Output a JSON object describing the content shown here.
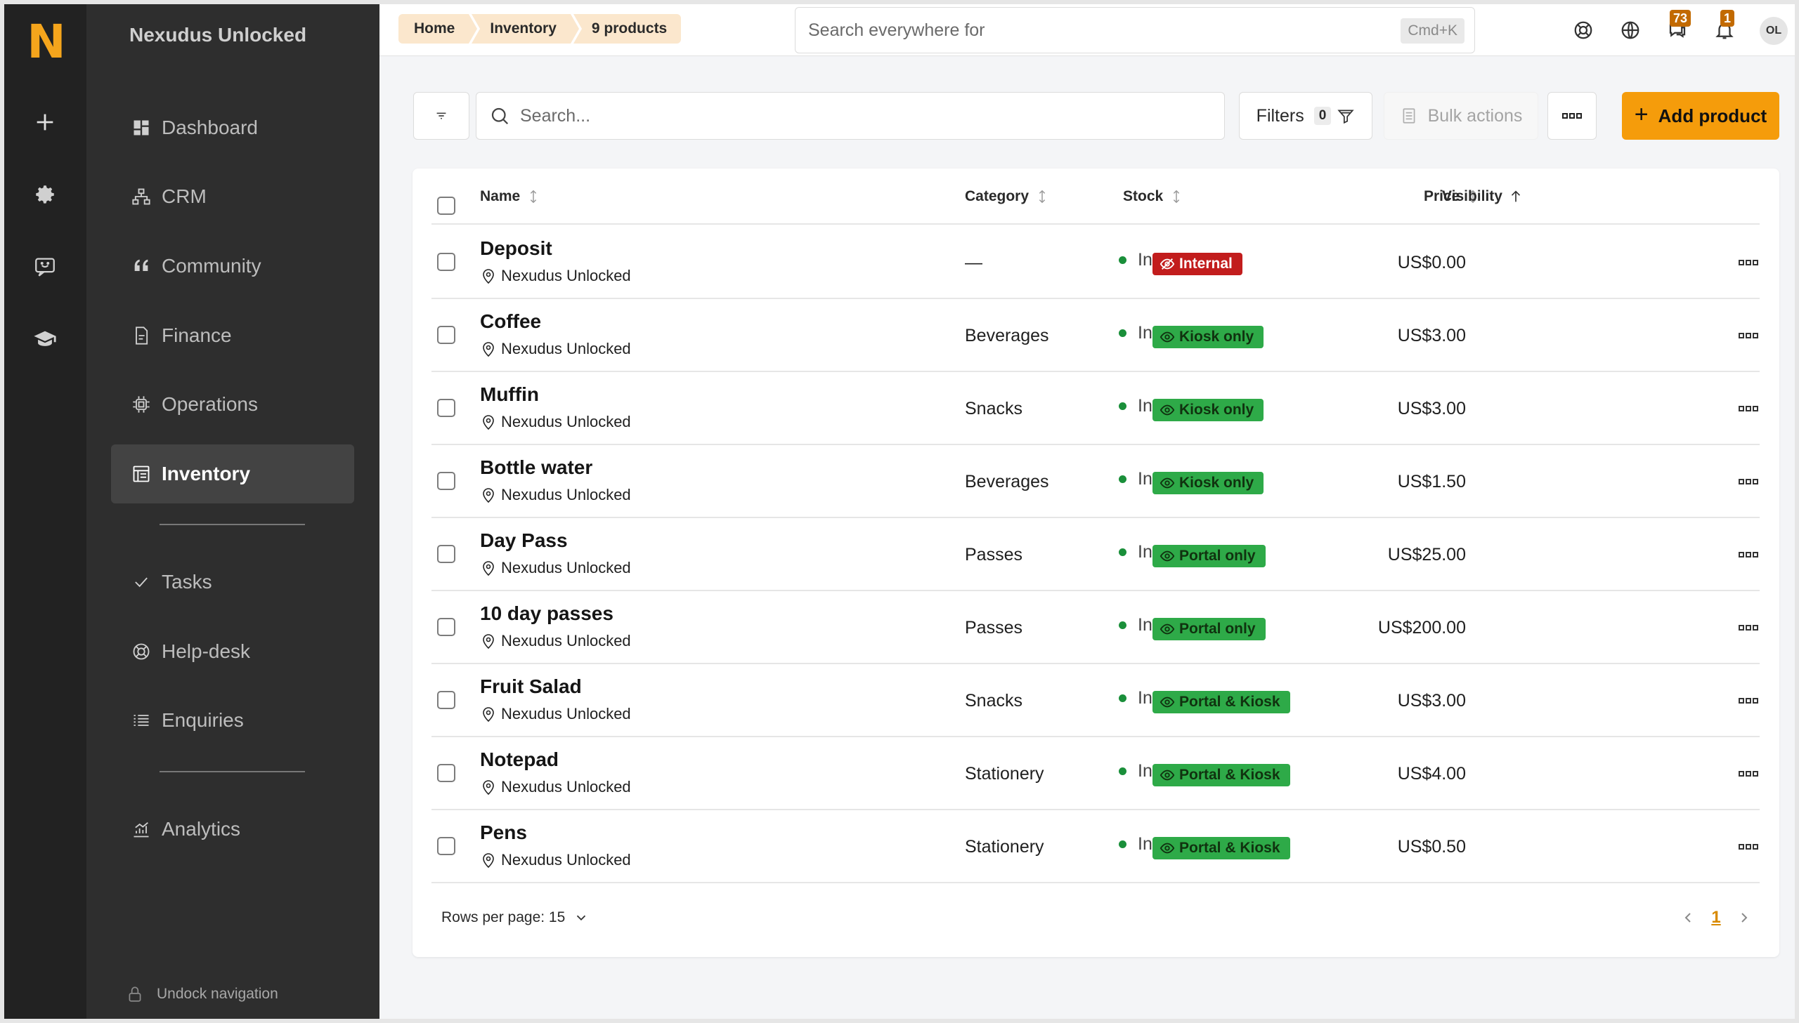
{
  "rail": {
    "logo": "N",
    "items": [
      {
        "icon": "plus-icon"
      },
      {
        "icon": "gear-icon"
      },
      {
        "icon": "chat-feedback-icon"
      },
      {
        "icon": "graduation-cap-icon"
      }
    ]
  },
  "sidebar": {
    "title": "Nexudus Unlocked",
    "items": [
      {
        "label": "Dashboard",
        "icon": "dashboard-icon"
      },
      {
        "label": "CRM",
        "icon": "org-chart-icon"
      },
      {
        "label": "Community",
        "icon": "quote-icon"
      },
      {
        "label": "Finance",
        "icon": "document-icon"
      },
      {
        "label": "Operations",
        "icon": "chip-icon"
      },
      {
        "label": "Inventory",
        "icon": "table-list-icon",
        "active": true
      },
      {
        "label": "Tasks",
        "icon": "check-icon"
      },
      {
        "label": "Help-desk",
        "icon": "lifebuoy-icon"
      },
      {
        "label": "Enquiries",
        "icon": "list-icon"
      },
      {
        "label": "Analytics",
        "icon": "chart-up-icon"
      }
    ],
    "undock_label": "Undock navigation"
  },
  "topbar": {
    "breadcrumbs": [
      "Home",
      "Inventory",
      "9 products"
    ],
    "search_placeholder": "Search everywhere for",
    "search_shortcut": "Cmd+K",
    "messages_badge": "73",
    "notifications_badge": "1",
    "avatar_initials": "OL"
  },
  "toolbar": {
    "search_placeholder": "Search...",
    "filters_label": "Filters",
    "filters_count": "0",
    "bulk_actions_label": "Bulk actions",
    "add_product_label": "Add product"
  },
  "table": {
    "columns": {
      "name": "Name",
      "category": "Category",
      "stock": "Stock",
      "price": "Price",
      "visibility": "Visibility"
    },
    "rows": [
      {
        "name": "Deposit",
        "location": "Nexudus Unlocked",
        "category": "—",
        "stock": "In stock",
        "price": "US$0.00",
        "visibility": "Internal",
        "visibility_color": "#c21d1d"
      },
      {
        "name": "Coffee",
        "location": "Nexudus Unlocked",
        "category": "Beverages",
        "stock": "In stock",
        "price": "US$3.00",
        "visibility": "Kiosk only",
        "visibility_color": "#2eaa48"
      },
      {
        "name": "Muffin",
        "location": "Nexudus Unlocked",
        "category": "Snacks",
        "stock": "In stock",
        "price": "US$3.00",
        "visibility": "Kiosk only",
        "visibility_color": "#2eaa48"
      },
      {
        "name": "Bottle water",
        "location": "Nexudus Unlocked",
        "category": "Beverages",
        "stock": "In stock",
        "price": "US$1.50",
        "visibility": "Kiosk only",
        "visibility_color": "#2eaa48"
      },
      {
        "name": "Day Pass",
        "location": "Nexudus Unlocked",
        "category": "Passes",
        "stock": "In stock",
        "price": "US$25.00",
        "visibility": "Portal only",
        "visibility_color": "#2eaa48"
      },
      {
        "name": "10 day passes",
        "location": "Nexudus Unlocked",
        "category": "Passes",
        "stock": "In stock",
        "price": "US$200.00",
        "visibility": "Portal only",
        "visibility_color": "#2eaa48"
      },
      {
        "name": "Fruit Salad",
        "location": "Nexudus Unlocked",
        "category": "Snacks",
        "stock": "In stock",
        "price": "US$3.00",
        "visibility": "Portal & Kiosk",
        "visibility_color": "#2eaa48"
      },
      {
        "name": "Notepad",
        "location": "Nexudus Unlocked",
        "category": "Stationery",
        "stock": "In stock",
        "price": "US$4.00",
        "visibility": "Portal & Kiosk",
        "visibility_color": "#2eaa48"
      },
      {
        "name": "Pens",
        "location": "Nexudus Unlocked",
        "category": "Stationery",
        "stock": "In stock",
        "price": "US$0.50",
        "visibility": "Portal & Kiosk",
        "visibility_color": "#2eaa48"
      }
    ],
    "rows_per_page_label": "Rows per page: 15",
    "current_page": "1"
  },
  "colors": {
    "accent": "#f59c0b",
    "stock_dot": "#1a8f3a"
  }
}
